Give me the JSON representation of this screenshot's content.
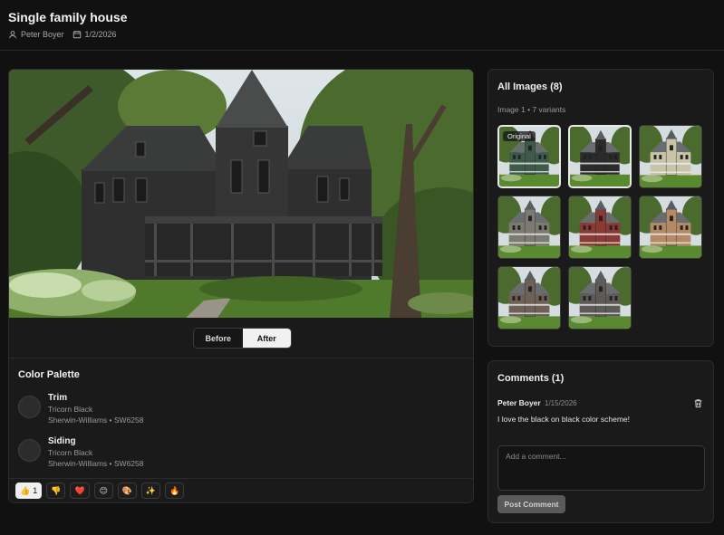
{
  "header": {
    "title": "Single family house",
    "author": "Peter Boyer",
    "date": "1/2/2026"
  },
  "toggle": {
    "before": "Before",
    "after": "After",
    "selected": "After"
  },
  "palette": {
    "title": "Color Palette",
    "items": [
      {
        "name": "Trim",
        "color_name": "Tricorn Black",
        "code": "Sherwin-Williams • SW6258"
      },
      {
        "name": "Siding",
        "color_name": "Tricorn Black",
        "code": "Sherwin-Williams • SW6258"
      }
    ]
  },
  "reactions": [
    {
      "icon": "👍",
      "count": "1",
      "active": true
    },
    {
      "icon": "👎"
    },
    {
      "icon": "❤️"
    },
    {
      "icon": "😊"
    },
    {
      "icon": "🎨"
    },
    {
      "icon": "✨"
    },
    {
      "icon": "🔥"
    }
  ],
  "images": {
    "title": "All Images (8)",
    "subtitle": "Image 1 • 7 variants",
    "original_badge": "Original",
    "thumb_colors": [
      "#3d5a4a",
      "#2b2b2b",
      "#c9c4a8",
      "#7d7a72",
      "#8a3a34",
      "#b48a66",
      "#6e6258",
      "#5e5a58"
    ]
  },
  "comments": {
    "title": "Comments (1)",
    "items": [
      {
        "author": "Peter Boyer",
        "date": "1/15/2026",
        "text": "I love the black on black color scheme!"
      }
    ],
    "placeholder": "Add a comment...",
    "post_label": "Post Comment"
  }
}
